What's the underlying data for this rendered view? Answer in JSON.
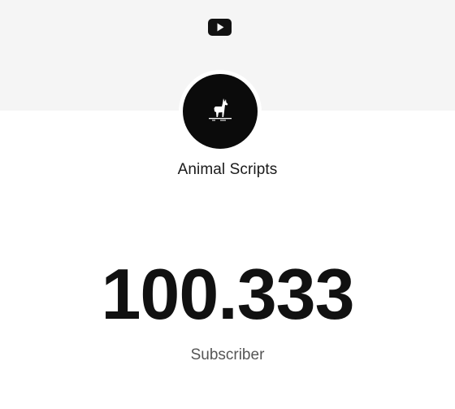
{
  "header": {
    "logo_icon": "youtube-play-icon",
    "background_color": "#f5f5f5"
  },
  "channel": {
    "avatar_icon": "llama-icon",
    "name": "Animal Scripts"
  },
  "stats": {
    "subscriber_count": "100.333",
    "subscriber_label": "Subscriber"
  }
}
